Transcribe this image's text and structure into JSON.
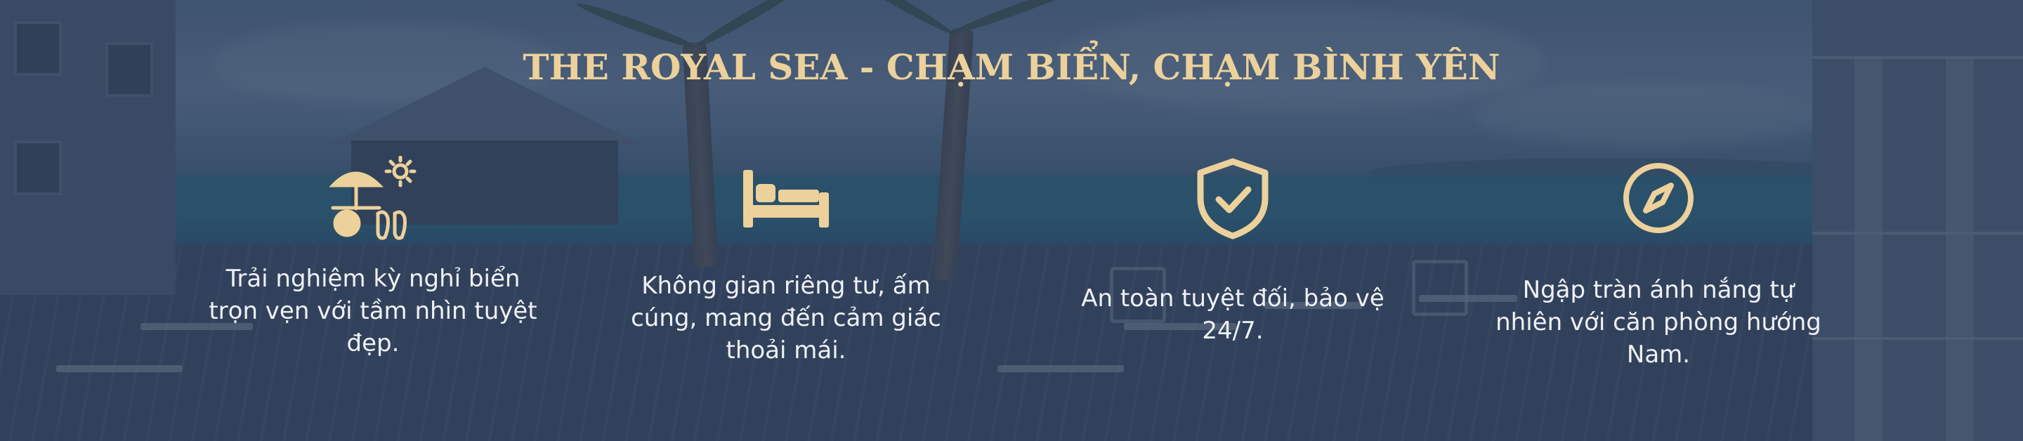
{
  "banner": {
    "title": "THE ROYAL SEA - CHẠM BIỂN, CHẠM BÌNH YÊN",
    "accent_color": "#ecd19b",
    "features": [
      {
        "icon": "beach-umbrella-icon",
        "text": "Trải nghiệm kỳ nghỉ biển trọn vẹn với tầm nhìn tuyệt đẹp."
      },
      {
        "icon": "bed-icon",
        "text": "Không gian riêng tư, ấm cúng, mang đến cảm giác thoải mái."
      },
      {
        "icon": "shield-check-icon",
        "text": "An toàn tuyệt đối, bảo vệ 24/7."
      },
      {
        "icon": "compass-icon",
        "text": "Ngập tràn ánh nắng tự nhiên với căn phòng hướng Nam."
      }
    ]
  }
}
